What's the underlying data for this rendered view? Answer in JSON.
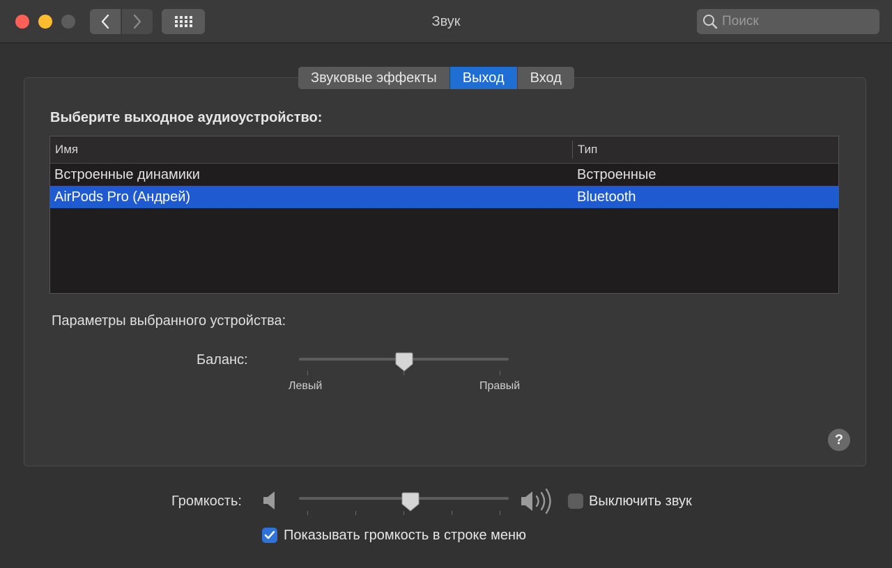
{
  "window": {
    "title": "Звук"
  },
  "toolbar": {
    "back_icon": "chevron-left-icon",
    "forward_icon": "chevron-right-icon",
    "grid_icon": "grid-icon"
  },
  "search": {
    "placeholder": "Поиск",
    "value": ""
  },
  "tabs": [
    {
      "label": "Звуковые эффекты",
      "active": false
    },
    {
      "label": "Выход",
      "active": true
    },
    {
      "label": "Вход",
      "active": false
    }
  ],
  "output": {
    "heading": "Выберите выходное аудиоустройство:",
    "columns": {
      "name": "Имя",
      "type": "Тип"
    },
    "devices": [
      {
        "name": "Встроенные динамики",
        "type": "Встроенные",
        "selected": false
      },
      {
        "name": "AirPods Pro (Андрей)",
        "type": "Bluetooth",
        "selected": true
      }
    ]
  },
  "params": {
    "label": "Параметры выбранного устройства:",
    "balance_label": "Баланс:",
    "balance_left": "Левый",
    "balance_right": "Правый",
    "balance_value": 0.5
  },
  "help": {
    "label": "?"
  },
  "volume": {
    "label": "Громкость:",
    "value": 0.53,
    "mute_label": "Выключить звук",
    "mute_checked": false,
    "show_in_menu_label": "Показывать громкость в строке меню",
    "show_in_menu_checked": true
  },
  "colors": {
    "accent": "#1f5ad1",
    "tab_active": "#1f6ed4"
  }
}
